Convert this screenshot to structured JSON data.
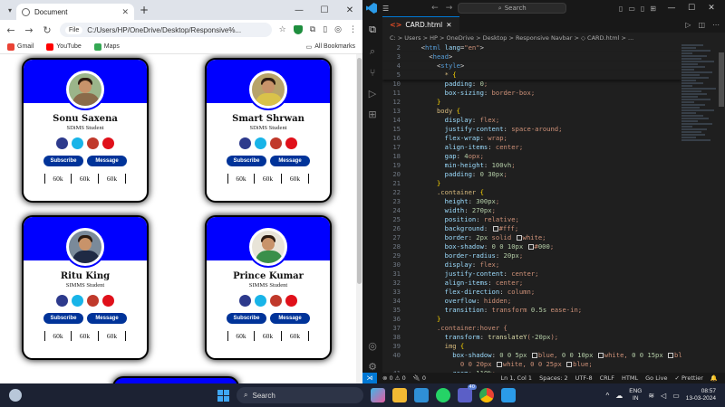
{
  "browser": {
    "tab_title": "Document",
    "address_chip": "File",
    "address": "C:/Users/HP/OneDrive/Desktop/Responsive%...",
    "bookmarks": [
      {
        "label": "Gmail",
        "color": "#ea4335"
      },
      {
        "label": "YouTube",
        "color": "#ff0000"
      },
      {
        "label": "Maps",
        "color": "#34a853"
      }
    ],
    "all_bookmarks": "All Bookmarks"
  },
  "cards": [
    {
      "name": "Sonu Saxena",
      "role": "SDiMS Student",
      "shirt": "#8a6b4a",
      "subscribe": "Subscribe",
      "message": "Message",
      "stats": [
        "60k",
        "60k",
        "60k"
      ]
    },
    {
      "name": "Smart Shrwan",
      "role": "SDiMS Student",
      "shirt": "#d9c24a",
      "subscribe": "Subscribe",
      "message": "Message",
      "stats": [
        "60k",
        "60k",
        "60k"
      ]
    },
    {
      "name": "Ritu King",
      "role": "SIMMS Student",
      "shirt": "#1f2a44",
      "subscribe": "Subscribe",
      "message": "Message",
      "stats": [
        "60k",
        "60k",
        "60k"
      ]
    },
    {
      "name": "Prince Kumar",
      "role": "SIMMS Student",
      "shirt": "#3a8f4a",
      "subscribe": "Subscribe",
      "message": "Message",
      "stats": [
        "60k",
        "60k",
        "60k"
      ]
    }
  ],
  "social_colors": [
    "#2d3a8c",
    "#18b4e8",
    "#c0392b",
    "#e0101a"
  ],
  "vscode": {
    "search": "Search",
    "tab": "CARD.html",
    "breadcrumb": "C: > Users > HP > OneDrive > Desktop > Responsive Navbar > ◇ CARD.html > ...",
    "code_lines": [
      {
        "n": "2",
        "t": "  <html lang=\"en\">"
      },
      {
        "n": "3",
        "t": "    <head>"
      },
      {
        "n": "4",
        "t": "      <style>"
      },
      {
        "n": "5",
        "t": "        * {"
      },
      {
        "n": "10",
        "t": "        padding: 0;"
      },
      {
        "n": "11",
        "t": "        box-sizing: border-box;"
      },
      {
        "n": "12",
        "t": "      }"
      },
      {
        "n": "13",
        "t": "      body {"
      },
      {
        "n": "14",
        "t": "        display: flex;"
      },
      {
        "n": "15",
        "t": "        justify-content: space-around;"
      },
      {
        "n": "16",
        "t": "        flex-wrap: wrap;"
      },
      {
        "n": "17",
        "t": "        align-items: center;"
      },
      {
        "n": "18",
        "t": "        gap: 4opx;"
      },
      {
        "n": "19",
        "t": "        min-height: 100vh;"
      },
      {
        "n": "20",
        "t": "        padding: 0 30px;"
      },
      {
        "n": "21",
        "t": "      }"
      },
      {
        "n": "22",
        "t": "      .container {"
      },
      {
        "n": "23",
        "t": "        height: 300px;"
      },
      {
        "n": "24",
        "t": "        width: 270px;"
      },
      {
        "n": "25",
        "t": "        position: relative;"
      },
      {
        "n": "26",
        "t": "        background: ■#fff;"
      },
      {
        "n": "27",
        "t": "        border: 2px solid ■white;"
      },
      {
        "n": "28",
        "t": "        box-shadow: 0 0 10px ■#000;"
      },
      {
        "n": "29",
        "t": "        border-radius: 20px;"
      },
      {
        "n": "30",
        "t": "        display: flex;"
      },
      {
        "n": "31",
        "t": "        justify-content: center;"
      },
      {
        "n": "32",
        "t": "        align-items: center;"
      },
      {
        "n": "33",
        "t": "        flex-direction: column;"
      },
      {
        "n": "34",
        "t": "        overflow: hidden;"
      },
      {
        "n": "35",
        "t": "        transition: transform 0.5s ease-in;"
      },
      {
        "n": "36",
        "t": "      }"
      },
      {
        "n": "37",
        "t": "      .container:hover {"
      },
      {
        "n": "38",
        "t": "        transform: translateY(-20px);"
      },
      {
        "n": "39",
        "t": "        img {"
      },
      {
        "n": "40",
        "t": "          box-shadow: 0 0 5px ■blue, 0 0 10px ■white, 0 0 15px ■blue,"
      },
      {
        "n": "",
        "t": "            0 0 20px ■white, 0 0 25px ■blue;"
      },
      {
        "n": "41",
        "t": "          zoom: 110%;"
      }
    ],
    "status": {
      "errors": "⊗ 0 ⚠ 0",
      "ports": "🔌 0",
      "position": "Ln 1, Col 1",
      "spaces": "Spaces: 2",
      "encoding": "UTF-8",
      "eol": "CRLF",
      "lang": "HTML",
      "golive": "Go Live",
      "prettier": "✓ Prettier"
    }
  },
  "taskbar": {
    "search": "Search",
    "lang_top": "ENG",
    "lang_bottom": "IN",
    "time": "08:57",
    "date": "13-03-2024",
    "badge": "40"
  }
}
